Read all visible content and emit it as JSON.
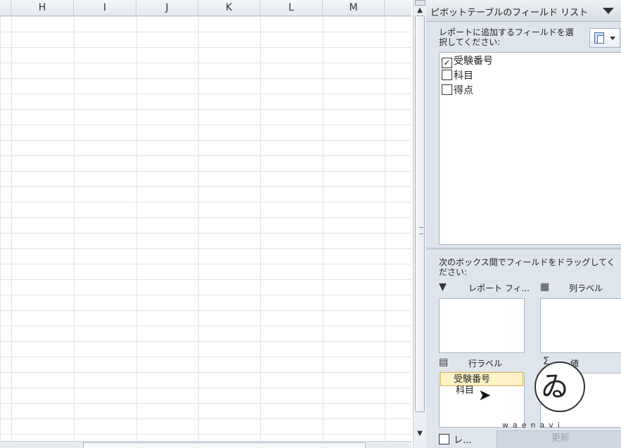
{
  "sheet": {
    "columns": [
      "H",
      "I",
      "J",
      "K",
      "L",
      "M"
    ]
  },
  "pane": {
    "title": "ピボットテーブルのフィールド リスト",
    "prompt": "レポートに追加するフィールドを選択してください:",
    "fields": [
      {
        "label": "受験番号",
        "checked": true
      },
      {
        "label": "科目",
        "checked": false
      },
      {
        "label": "得点",
        "checked": false
      }
    ],
    "drag_prompt": "次のボックス間でフィールドをドラッグしてください:",
    "areas": {
      "report_filter": "レポート フィ...",
      "column_labels": "列ラベル",
      "row_labels": "行ラベル",
      "values": "値"
    },
    "row_chip": "受験番号",
    "drag_ghost": "科目",
    "defer_label": "レ...",
    "update_button": "更新"
  },
  "watermark": {
    "text": "waenavi"
  }
}
